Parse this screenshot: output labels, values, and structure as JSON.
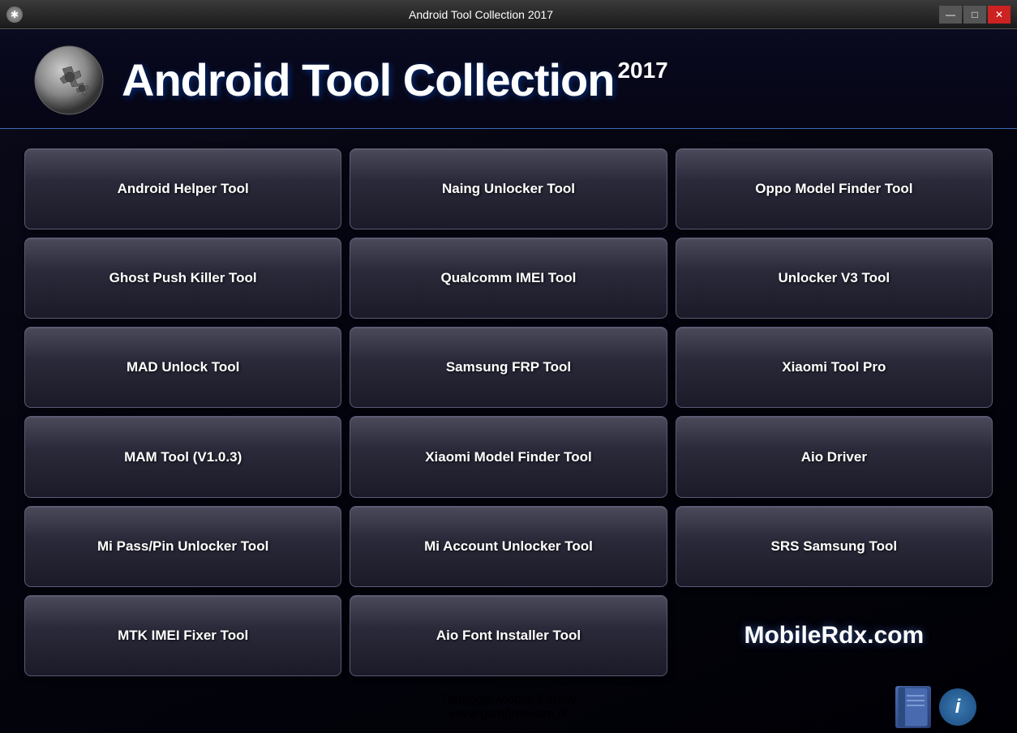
{
  "titlebar": {
    "title": "Android Tool Collection 2017",
    "minimize_label": "—",
    "maximize_label": "□",
    "close_label": "✕"
  },
  "header": {
    "title": "Android Tool Collection",
    "year": "2017"
  },
  "buttons": [
    {
      "id": "android-helper",
      "label": "Android Helper Tool",
      "row": 1,
      "col": 1
    },
    {
      "id": "naing-unlocker",
      "label": "Naing Unlocker Tool",
      "row": 1,
      "col": 2
    },
    {
      "id": "oppo-model-finder",
      "label": "Oppo Model Finder Tool",
      "row": 1,
      "col": 3
    },
    {
      "id": "ghost-push-killer",
      "label": "Ghost Push Killer Tool",
      "row": 2,
      "col": 1
    },
    {
      "id": "qualcomm-imei",
      "label": "Qualcomm IMEI Tool",
      "row": 2,
      "col": 2
    },
    {
      "id": "unlocker-v3",
      "label": "Unlocker V3 Tool",
      "row": 2,
      "col": 3
    },
    {
      "id": "mad-unlock",
      "label": "MAD Unlock Tool",
      "row": 3,
      "col": 1
    },
    {
      "id": "samsung-frp",
      "label": "Samsung FRP Tool",
      "row": 3,
      "col": 2
    },
    {
      "id": "xiaomi-tool-pro",
      "label": "Xiaomi Tool Pro",
      "row": 3,
      "col": 3
    },
    {
      "id": "mam-tool",
      "label": "MAM Tool (V1.0.3)",
      "row": 4,
      "col": 1
    },
    {
      "id": "xiaomi-model-finder",
      "label": "Xiaomi Model Finder Tool",
      "row": 4,
      "col": 2
    },
    {
      "id": "aio-driver",
      "label": "Aio Driver",
      "row": 4,
      "col": 3
    },
    {
      "id": "mi-pass-pin",
      "label": "Mi Pass/Pin Unlocker Tool",
      "row": 5,
      "col": 1
    },
    {
      "id": "mi-account",
      "label": "Mi Account Unlocker Tool",
      "row": 5,
      "col": 2
    },
    {
      "id": "srs-samsung",
      "label": "SRS Samsung Tool",
      "row": 5,
      "col": 3
    },
    {
      "id": "mtk-imei-fixer",
      "label": "MTK IMEI Fixer Tool",
      "row": 6,
      "col": 1
    },
    {
      "id": "aio-font-installer",
      "label": "Aio Font Installer Tool",
      "row": 6,
      "col": 2
    }
  ],
  "mobilerdx": {
    "text": "MobileRdx.com"
  },
  "footer": {
    "family": "Taunggyi Mobile Family",
    "website": "www.gsmfirmware.tk"
  }
}
